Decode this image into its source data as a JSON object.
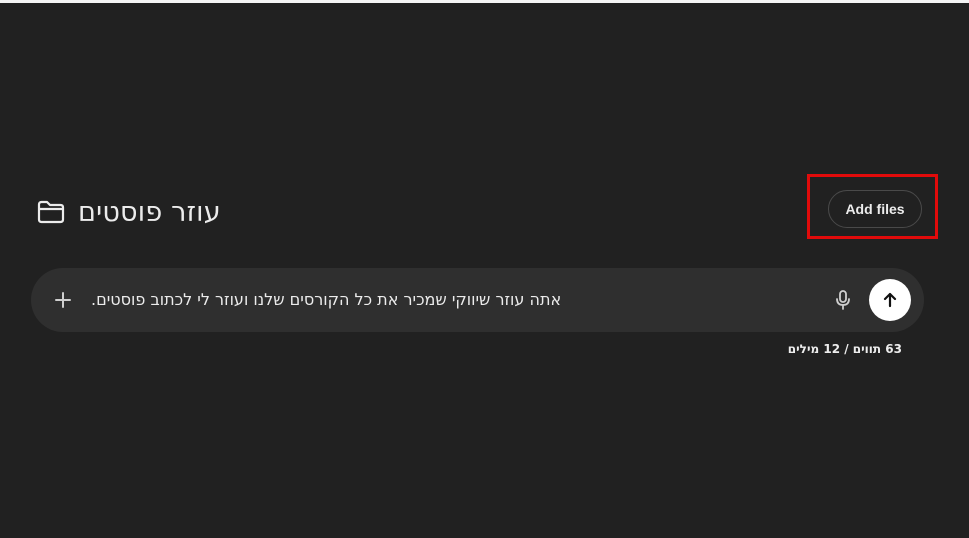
{
  "project": {
    "title": "עוזר פוסטים",
    "icon": "folder-icon"
  },
  "actions": {
    "add_files_label": "Add files"
  },
  "composer": {
    "prompt_text": "אתה עוזר שיווקי שמכיר את כל הקורסים שלנו ועוזר לי לכתוב פוסטים.",
    "plus_icon": "plus-icon",
    "mic_icon": "microphone-icon",
    "send_icon": "arrow-up-icon"
  },
  "counter": {
    "text": "63 תווים / 12 מילים"
  },
  "colors": {
    "background": "#212121",
    "composer": "#2f2f2f",
    "highlight": "#e10b0b",
    "send_button": "#ffffff"
  }
}
